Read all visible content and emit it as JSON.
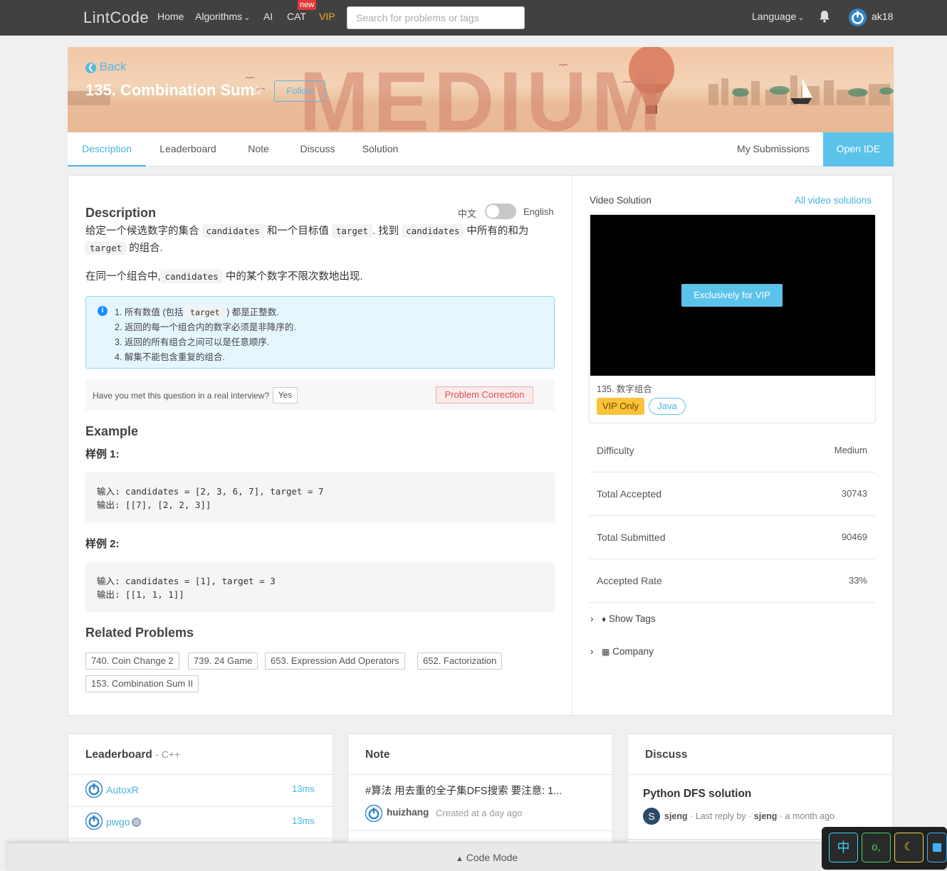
{
  "nav": {
    "logo": "LintCode",
    "links": [
      "Home",
      "Algorithms",
      "AI",
      "CAT",
      "VIP"
    ],
    "new_badge": "new",
    "search_placeholder": "Search for problems or tags",
    "language": "Language",
    "username": "ak18"
  },
  "banner": {
    "back": "Back",
    "title": "135. Combination Sum",
    "follow": "Follow",
    "watermark": "MEDIUM"
  },
  "tabs": {
    "items": [
      "Description",
      "Leaderboard",
      "Note",
      "Discuss",
      "Solution"
    ],
    "my_submissions": "My Submissions",
    "open_ide": "Open IDE"
  },
  "description": {
    "heading": "Description",
    "lang_zh": "中文",
    "lang_en": "English",
    "p1_a": "给定一个候选数字的集合",
    "p1_code1": "candidates",
    "p1_b": "和一个目标值",
    "p1_code2": "target",
    "p1_c": ". 找到",
    "p1_code3": "candidates",
    "p1_d": "中所有的和为",
    "p1_code4": "target",
    "p1_e": "的组合.",
    "p2_a": "在同一个组合中,",
    "p2_code": "candidates",
    "p2_b": "中的某个数字不限次数地出现.",
    "notes": {
      "n1_a": "1. 所有数值 (包括",
      "n1_code": "target",
      "n1_b": ") 都是正整数.",
      "n2": "2. 返回的每一个组合内的数字必须是非降序的.",
      "n3": "3. 返回的所有组合之间可以是任意顺序.",
      "n4": "4. 解集不能包含重复的组合."
    },
    "interview_q": "Have you met this question in a real interview?",
    "yes": "Yes",
    "correction": "Problem Correction"
  },
  "example": {
    "heading": "Example",
    "ex1_label": "样例 1:",
    "ex1_in": "输入: candidates = [2, 3, 6, 7], target = 7",
    "ex1_out": "输出: [[7], [2, 2, 3]]",
    "ex2_label": "样例 2:",
    "ex2_in": "输入: candidates = [1], target = 3",
    "ex2_out": "输出: [[1, 1, 1]]"
  },
  "related": {
    "heading": "Related Problems",
    "items": [
      "740. Coin Change 2",
      "739. 24 Game",
      "653. Expression Add Operators",
      "652. Factorization",
      "153. Combination Sum II"
    ]
  },
  "video": {
    "title": "Video Solution",
    "all": "All video solutions",
    "vip_button": "Exclusively for VIP",
    "name": "135. 数字组合",
    "vip_only": "VIP Only",
    "lang": "Java"
  },
  "stats": {
    "difficulty_label": "Difficulty",
    "difficulty": "Medium",
    "accepted_label": "Total Accepted",
    "accepted": "30743",
    "submitted_label": "Total Submitted",
    "submitted": "90469",
    "rate_label": "Accepted Rate",
    "rate": "33%",
    "show_tags": "Show Tags",
    "company": "Company"
  },
  "leaderboard": {
    "heading": "Leaderboard",
    "sub": "- C++",
    "rows": [
      {
        "name": "AutoxR",
        "time": "13ms"
      },
      {
        "name": "pwgo",
        "time": "13ms"
      }
    ]
  },
  "note": {
    "heading": "Note",
    "title": "#算法 用去重的全子集DFS搜索 要注意: 1...",
    "user": "huizhang",
    "meta": "Created at a day ago"
  },
  "discuss": {
    "heading": "Discuss",
    "title": "Python DFS solution",
    "avatar_letter": "S",
    "user": "sjeng",
    "meta_mid": "· Last reply by ·",
    "reply_user": "sjeng",
    "meta_end": "· a month ago"
  },
  "code_mode": "Code Mode",
  "ime": {
    "k1": "中",
    "k2": "o,"
  }
}
